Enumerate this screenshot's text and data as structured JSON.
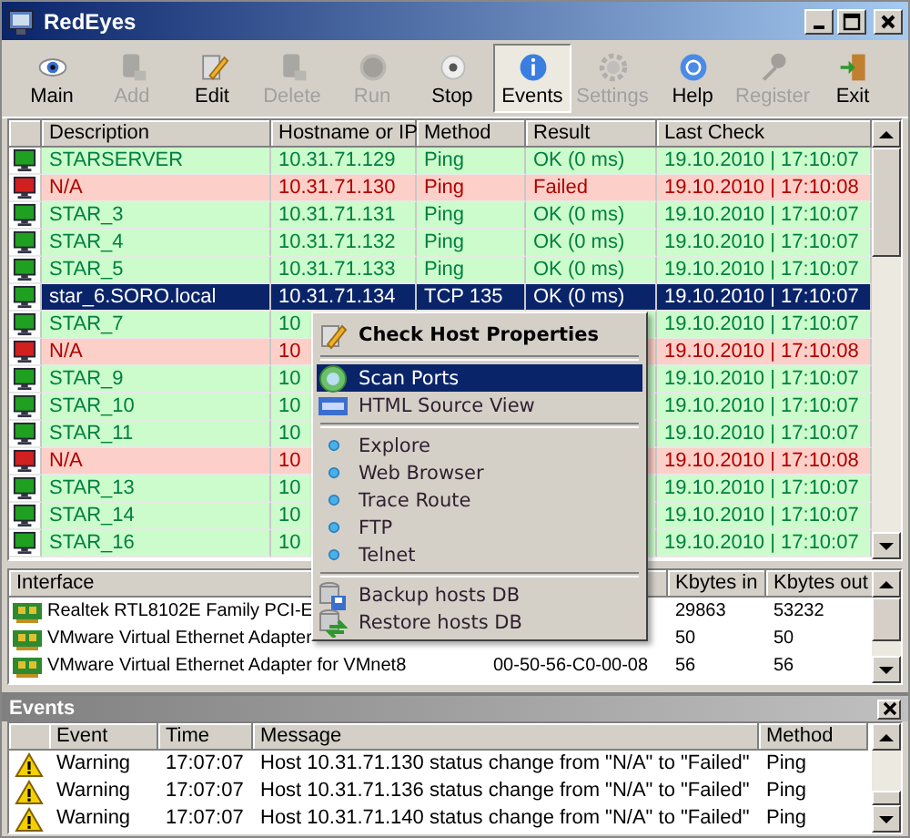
{
  "window": {
    "title": "RedEyes"
  },
  "toolbar": [
    {
      "label": "Main",
      "kind": "eye",
      "disabled": false,
      "selected": false
    },
    {
      "label": "Add",
      "kind": "add",
      "disabled": true,
      "selected": false
    },
    {
      "label": "Edit",
      "kind": "edit",
      "disabled": false,
      "selected": false
    },
    {
      "label": "Delete",
      "kind": "delete",
      "disabled": true,
      "selected": false
    },
    {
      "label": "Run",
      "kind": "run",
      "disabled": true,
      "selected": false
    },
    {
      "label": "Stop",
      "kind": "stop",
      "disabled": false,
      "selected": false
    },
    {
      "label": "Events",
      "kind": "info",
      "disabled": false,
      "selected": true
    },
    {
      "label": "Settings",
      "kind": "gear",
      "disabled": true,
      "selected": false
    },
    {
      "label": "Help",
      "kind": "help",
      "disabled": false,
      "selected": false
    },
    {
      "label": "Register",
      "kind": "key",
      "disabled": true,
      "selected": false
    },
    {
      "label": "Exit",
      "kind": "exit",
      "disabled": false,
      "selected": false
    }
  ],
  "hosts": {
    "columns": [
      "Description",
      "Hostname or IP",
      "Method",
      "Result",
      "Last Check"
    ],
    "rows": [
      {
        "description": "STARSERVER",
        "host": "10.31.71.129",
        "method": "Ping",
        "result": "OK (0 ms)",
        "last_check": "19.10.2010 | 17:10:07",
        "failed": false,
        "selected": false
      },
      {
        "description": "N/A",
        "host": "10.31.71.130",
        "method": "Ping",
        "result": "Failed",
        "last_check": "19.10.2010 | 17:10:08",
        "failed": true,
        "selected": false
      },
      {
        "description": "STAR_3",
        "host": "10.31.71.131",
        "method": "Ping",
        "result": "OK (0 ms)",
        "last_check": "19.10.2010 | 17:10:07",
        "failed": false,
        "selected": false
      },
      {
        "description": "STAR_4",
        "host": "10.31.71.132",
        "method": "Ping",
        "result": "OK (0 ms)",
        "last_check": "19.10.2010 | 17:10:07",
        "failed": false,
        "selected": false
      },
      {
        "description": "STAR_5",
        "host": "10.31.71.133",
        "method": "Ping",
        "result": "OK (0 ms)",
        "last_check": "19.10.2010 | 17:10:07",
        "failed": false,
        "selected": false
      },
      {
        "description": "star_6.SORO.local",
        "host": "10.31.71.134",
        "method": "TCP 135",
        "result": "OK (0 ms)",
        "last_check": "19.10.2010 | 17:10:07",
        "failed": false,
        "selected": true
      },
      {
        "description": "STAR_7",
        "host": "10",
        "last_check": "19.10.2010 | 17:10:07",
        "failed": false,
        "selected": false
      },
      {
        "description": "N/A",
        "host": "10",
        "last_check": "19.10.2010 | 17:10:08",
        "failed": true,
        "selected": false
      },
      {
        "description": "STAR_9",
        "host": "10",
        "last_check": "19.10.2010 | 17:10:07",
        "failed": false,
        "selected": false
      },
      {
        "description": "STAR_10",
        "host": "10",
        "last_check": "19.10.2010 | 17:10:07",
        "failed": false,
        "selected": false
      },
      {
        "description": "STAR_11",
        "host": "10",
        "last_check": "19.10.2010 | 17:10:07",
        "failed": false,
        "selected": false
      },
      {
        "description": "N/A",
        "host": "10",
        "last_check": "19.10.2010 | 17:10:08",
        "failed": true,
        "selected": false
      },
      {
        "description": "STAR_13",
        "host": "10",
        "last_check": "19.10.2010 | 17:10:07",
        "failed": false,
        "selected": false
      },
      {
        "description": "STAR_14",
        "host": "10",
        "last_check": "19.10.2010 | 17:10:07",
        "failed": false,
        "selected": false
      },
      {
        "description": "STAR_16",
        "host": "10",
        "last_check": "19.10.2010 | 17:10:07",
        "failed": false,
        "selected": false
      }
    ]
  },
  "context_menu": [
    {
      "label": "Check Host Properties",
      "kind": "header",
      "selected": false
    },
    {
      "kind": "separator"
    },
    {
      "label": "Scan Ports",
      "kind": "scan",
      "selected": true
    },
    {
      "label": "HTML Source View",
      "kind": "html",
      "selected": false
    },
    {
      "kind": "separator"
    },
    {
      "label": "Explore",
      "kind": "bullet",
      "selected": false
    },
    {
      "label": "Web Browser",
      "kind": "bullet",
      "selected": false
    },
    {
      "label": "Trace Route",
      "kind": "bullet",
      "selected": false
    },
    {
      "label": "FTP",
      "kind": "bullet",
      "selected": false
    },
    {
      "label": "Telnet",
      "kind": "bullet",
      "selected": false
    },
    {
      "kind": "separator"
    },
    {
      "label": "Backup hosts DB",
      "kind": "backup",
      "selected": false
    },
    {
      "label": "Restore hosts DB",
      "kind": "restore",
      "selected": false
    }
  ],
  "interfaces": {
    "columns": [
      "Interface",
      "",
      "Kbytes in",
      "Kbytes out"
    ],
    "rows": [
      {
        "interface": "Realtek RTL8102E Family PCI-E",
        "kbytes_in": "29863",
        "kbytes_out": "53232"
      },
      {
        "interface": "VMware Virtual Ethernet Adapter",
        "kbytes_in": "50",
        "kbytes_out": "50"
      },
      {
        "interface": "VMware Virtual Ethernet Adapter for VMnet8",
        "mac": "00-50-56-C0-00-08",
        "kbytes_in": "56",
        "kbytes_out": "56"
      }
    ]
  },
  "events": {
    "title": "Events",
    "columns": [
      "Event",
      "Time",
      "Message",
      "Method"
    ],
    "rows": [
      {
        "event": "Warning",
        "time": "17:07:07",
        "message": "Host 10.31.71.130 status change from \"N/A\" to \"Failed\"",
        "method": "Ping"
      },
      {
        "event": "Warning",
        "time": "17:07:07",
        "message": "Host 10.31.71.136 status change from \"N/A\" to \"Failed\"",
        "method": "Ping"
      },
      {
        "event": "Warning",
        "time": "17:07:07",
        "message": "Host 10.31.71.140 status change from \"N/A\" to \"Failed\"",
        "method": "Ping"
      }
    ]
  }
}
